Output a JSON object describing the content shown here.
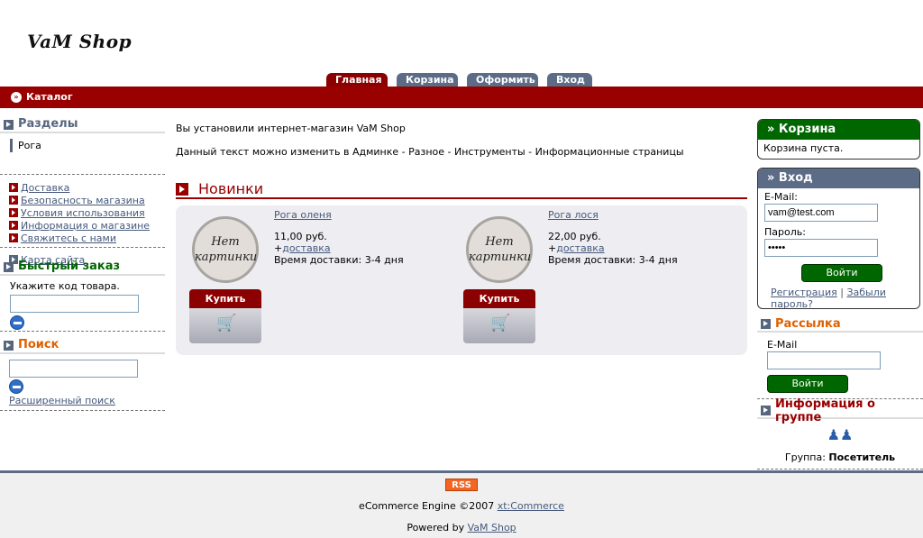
{
  "header": {
    "logo_text": "VaM Shop",
    "tabs": [
      "Главная",
      "Корзина",
      "Оформить",
      "Вход"
    ],
    "catalog_label": "Каталог"
  },
  "left": {
    "sections_title": "Разделы",
    "category": "Рога",
    "links": [
      "Доставка",
      "Безопасность магазина",
      "Условия использования",
      "Информация о магазине",
      "Свяжитесь с нами"
    ],
    "sitemap": "Карта сайта",
    "quick_order_title": "Быстрый заказ",
    "quick_order_hint": "Укажите код товара.",
    "search_title": "Поиск",
    "advanced_search": "Расширенный поиск"
  },
  "main": {
    "intro1": "Вы установили интернет-магазин VaM Shop",
    "intro2": "Данный текст можно изменить в Админке - Разное - Инструменты - Информационные страницы",
    "new_title": "Новинки",
    "products": [
      {
        "name": "Рога оленя",
        "no_image": "Нет картинки",
        "price": "11,00 руб.",
        "plus": "+",
        "delivery_link": "доставка",
        "delivery_time": "Время доставки:  3-4 дня",
        "buy": "Купить"
      },
      {
        "name": "Рога лося",
        "no_image": "Нет картинки",
        "price": "22,00 руб.",
        "plus": "+",
        "delivery_link": "доставка",
        "delivery_time": "Время доставки:  3-4 дня",
        "buy": "Купить"
      }
    ]
  },
  "right": {
    "cart_title": "» Корзина",
    "cart_empty": "Корзина пуста.",
    "login_title": "» Вход",
    "email_label": "E-Mail:",
    "email_value": "vam@test.com",
    "password_label": "Пароль:",
    "password_value": "•••••",
    "login_button": "Войти",
    "register_link": "Регистрация",
    "separator": "|",
    "forgot_link": "Забыли пароль?",
    "newsletter_title": "Рассылка",
    "newsletter_email_label": "E-Mail",
    "newsletter_button": "Войти",
    "group_title": "Информация о группе",
    "group_label": "Группа:",
    "group_value": "Посетитель"
  },
  "footer": {
    "rss": "RSS",
    "engine_prefix": "eCommerce Engine ©2007 ",
    "engine_link": "xt:Commerce",
    "powered_prefix": "Powered by ",
    "powered_link": "VaM Shop"
  },
  "colors": {
    "brand_red": "#990000",
    "slate": "#5c6c87",
    "green": "#006600",
    "orange_heading": "#e06000"
  }
}
